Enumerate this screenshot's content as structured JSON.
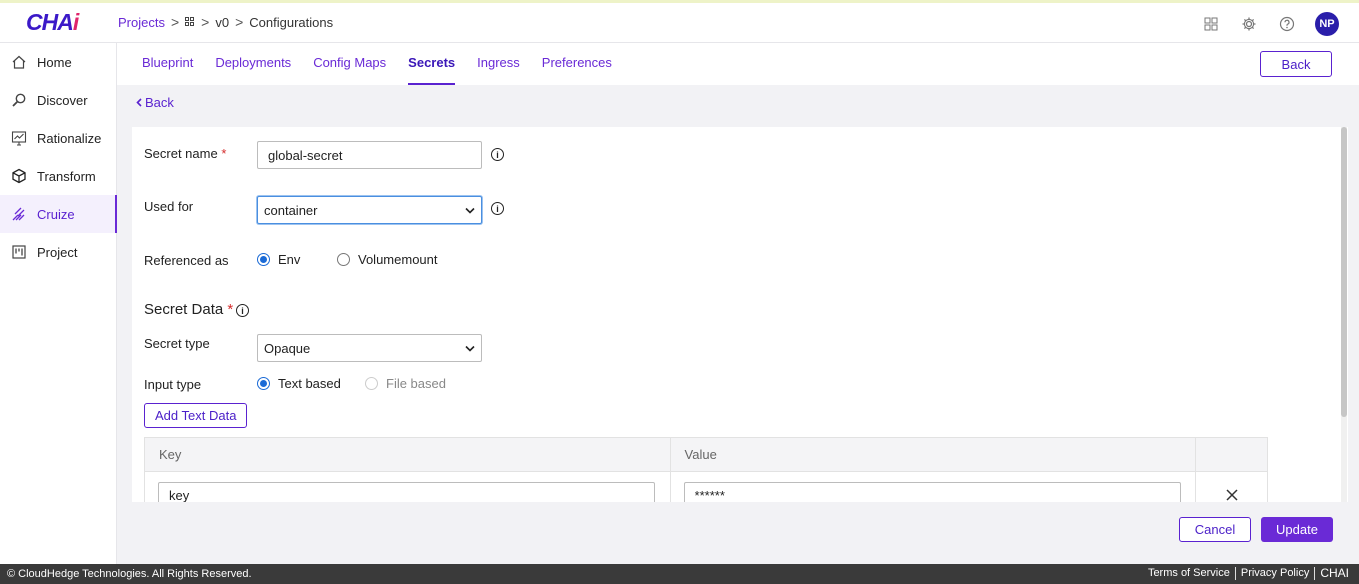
{
  "logo": {
    "main": "CHA",
    "accent": "i"
  },
  "breadcrumb": {
    "projects": "Projects",
    "sep1": ">",
    "sep2": ">",
    "version": "v0",
    "sep3": ">",
    "current": "Configurations"
  },
  "user": {
    "initials": "NP"
  },
  "sidebar": {
    "items": [
      {
        "label": "Home",
        "icon": "home-icon"
      },
      {
        "label": "Discover",
        "icon": "discover-icon"
      },
      {
        "label": "Rationalize",
        "icon": "rationalize-icon"
      },
      {
        "label": "Transform",
        "icon": "transform-icon"
      },
      {
        "label": "Cruize",
        "icon": "cruize-icon",
        "active": true
      },
      {
        "label": "Project",
        "icon": "project-icon"
      }
    ]
  },
  "tabs": {
    "items": [
      "Blueprint",
      "Deployments",
      "Config Maps",
      "Secrets",
      "Ingress",
      "Preferences"
    ],
    "active": "Secrets",
    "back_label": "Back"
  },
  "back_link": "Back",
  "form": {
    "secret_name_label": "Secret name",
    "required_mark": "*",
    "secret_name_value": "global-secret",
    "used_for_label": "Used for",
    "used_for_value": "container",
    "referenced_as_label": "Referenced as",
    "ref_env": "Env",
    "ref_volumemount": "Volumemount",
    "secret_data_title": "Secret Data",
    "secret_type_label": "Secret type",
    "secret_type_value": "Opaque",
    "input_type_label": "Input type",
    "input_text": "Text based",
    "input_file": "File based",
    "add_text_data": "Add Text Data",
    "info_glyph": "i"
  },
  "table": {
    "headers": {
      "key": "Key",
      "value": "Value"
    },
    "rows": [
      {
        "key": "key",
        "value": "******"
      }
    ]
  },
  "actions": {
    "cancel": "Cancel",
    "update": "Update"
  },
  "footer": {
    "copyright": "© CloudHedge Technologies. All Rights Reserved.",
    "terms": "Terms of Service",
    "privacy": "Privacy Policy",
    "brand": "CHAI"
  },
  "colors": {
    "accent": "#6a2ad6",
    "brand": "#3b19c8",
    "footer": "#3a3a3a"
  }
}
